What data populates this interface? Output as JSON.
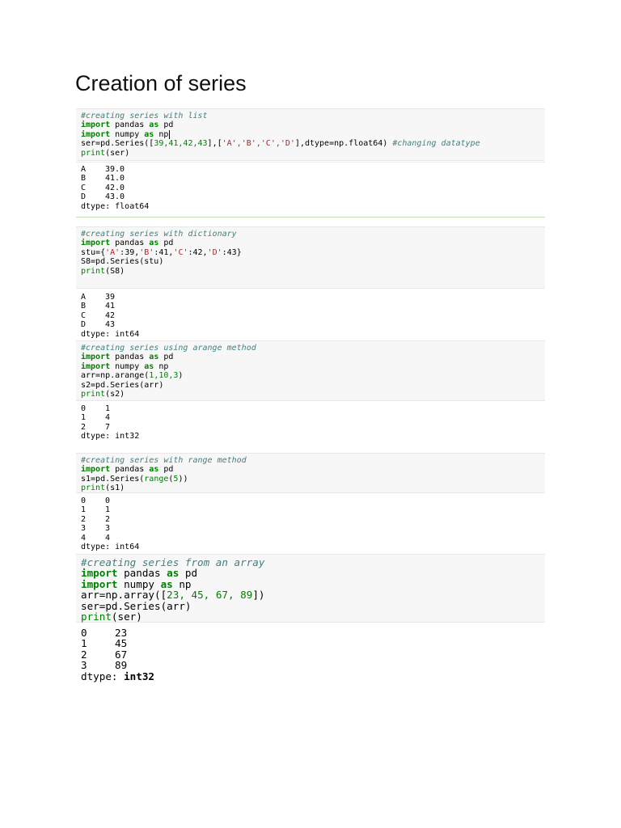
{
  "title": "Creation of series",
  "cells": [
    {
      "code": {
        "comment1": "#creating series with list",
        "l2_kw1": "import",
        "l2_mod": " pandas ",
        "l2_kw2": "as",
        "l2_alias": " pd",
        "l3_kw1": "import",
        "l3_mod": " numpy ",
        "l3_kw2": "as",
        "l3_alias": " np",
        "l4_a": "ser=pd.Series([",
        "l4_n": "39,41,42,43",
        "l4_b": "],[",
        "l4_s": "'A','B','C','D'",
        "l4_c": "],dtype=np.float64) ",
        "l4_cm": "#changing datatype",
        "l5_fn": "print",
        "l5_rest": "(ser)"
      },
      "output": {
        "rows": [
          [
            "A",
            "39.0"
          ],
          [
            "B",
            "41.0"
          ],
          [
            "C",
            "42.0"
          ],
          [
            "D",
            "43.0"
          ]
        ],
        "dtype": "dtype: float64"
      }
    },
    {
      "code": {
        "comment1": "#creating series with dictionary",
        "l2_kw1": "import",
        "l2_mod": " pandas ",
        "l2_kw2": "as",
        "l2_alias": " pd",
        "l3_a": "stu={",
        "l3_s1": "'A'",
        "l3_b": ":39,",
        "l3_s2": "'B'",
        "l3_c": ":41,",
        "l3_s3": "'C'",
        "l3_d": ":42,",
        "l3_s4": "'D'",
        "l3_e": ":43}",
        "l4": "S8=pd.Series(stu)",
        "l5_fn": "print",
        "l5_rest": "(S8)"
      },
      "output": {
        "rows": [
          [
            "A",
            "39"
          ],
          [
            "B",
            "41"
          ],
          [
            "C",
            "42"
          ],
          [
            "D",
            "43"
          ]
        ],
        "dtype": "dtype: int64"
      }
    },
    {
      "code": {
        "comment1": "#creating series using arange method",
        "l2_kw1": "import",
        "l2_mod": " pandas ",
        "l2_kw2": "as",
        "l2_alias": " pd",
        "l3_kw1": "import",
        "l3_mod": " numpy ",
        "l3_kw2": "as",
        "l3_alias": " np",
        "l4_a": "arr=np.arange(",
        "l4_n": "1,10,3",
        "l4_b": ")",
        "l5": "s2=pd.Series(arr)",
        "l6_fn": "print",
        "l6_rest": "(s2)"
      },
      "output": {
        "rows": [
          [
            "0",
            "1"
          ],
          [
            "1",
            "4"
          ],
          [
            "2",
            "7"
          ]
        ],
        "dtype": "dtype: int32"
      }
    },
    {
      "code": {
        "comment1": "#creating series with range method",
        "l2_kw1": "import",
        "l2_mod": " pandas ",
        "l2_kw2": "as",
        "l2_alias": " pd",
        "l3_a": "s1=pd.Series(",
        "l3_fn": "range",
        "l3_b": "(",
        "l3_n": "5",
        "l3_c": "))",
        "l4_fn": "print",
        "l4_rest": "(s1)"
      },
      "output": {
        "rows": [
          [
            "0",
            "0"
          ],
          [
            "1",
            "1"
          ],
          [
            "2",
            "2"
          ],
          [
            "3",
            "3"
          ],
          [
            "4",
            "4"
          ]
        ],
        "dtype": "dtype: int64"
      }
    },
    {
      "code": {
        "comment1": "#creating series from an array",
        "l2_kw1": "import",
        "l2_mod": " pandas ",
        "l2_kw2": "as",
        "l2_alias": " pd",
        "l3_kw1": "import",
        "l3_mod": " numpy ",
        "l3_kw2": "as",
        "l3_alias": " np",
        "l4_a": "arr=np.array([",
        "l4_n": "23, 45, 67, 89",
        "l4_b": "])",
        "l5": "ser=pd.Series(arr)",
        "l6_fn": "print",
        "l6_rest": "(ser)"
      },
      "output": {
        "rows": [
          [
            "0",
            "23"
          ],
          [
            "1",
            "45"
          ],
          [
            "2",
            "67"
          ],
          [
            "3",
            "89"
          ]
        ],
        "dtype_label": "dtype: ",
        "dtype_value": "int32"
      }
    }
  ]
}
